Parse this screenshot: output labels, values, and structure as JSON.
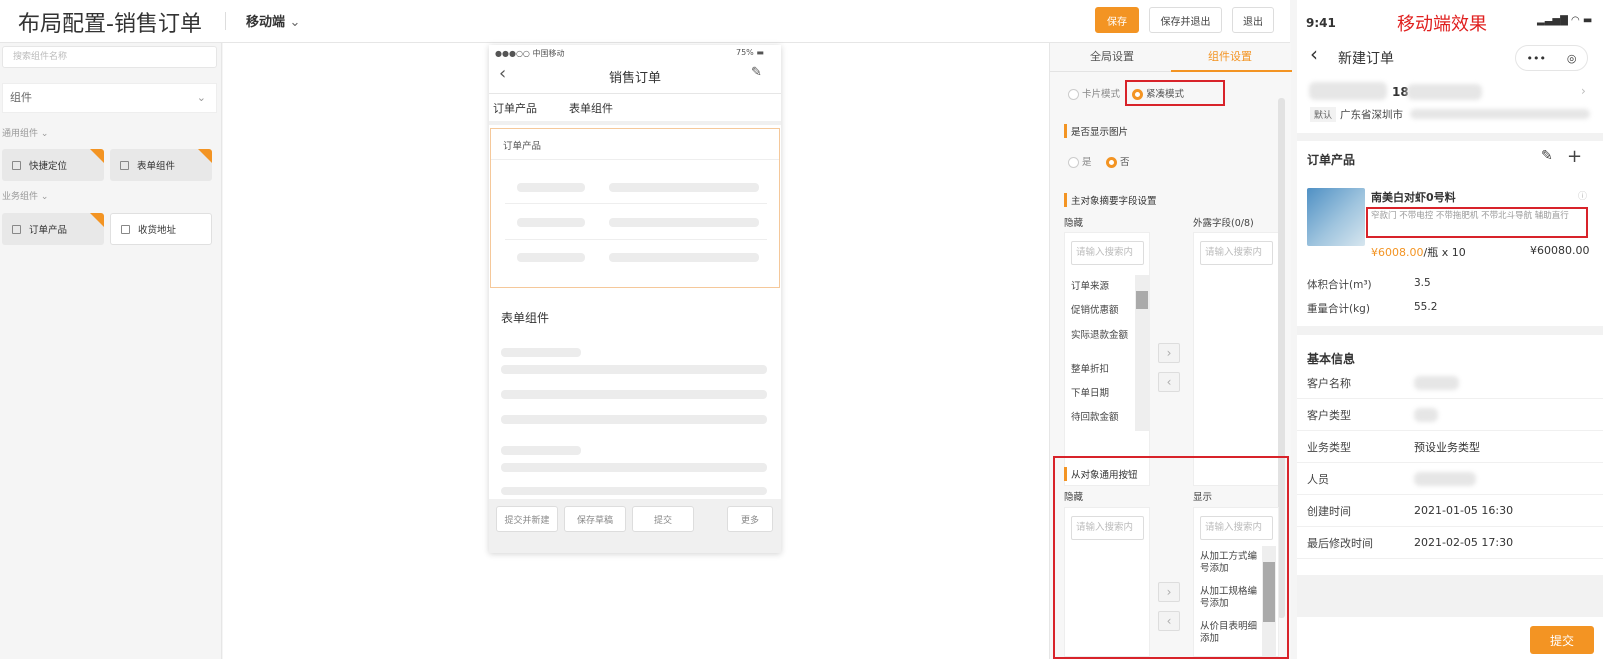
{
  "header": {
    "title": "布局配置-销售订单",
    "mode": "移动端",
    "save": "保存",
    "save_exit": "保存并退出",
    "exit": "退出"
  },
  "left": {
    "search_placeholder": "搜索组件名称",
    "group": "组件",
    "general_section": "通用组件",
    "business_section": "业务组件",
    "general_items": [
      "快捷定位",
      "表单组件"
    ],
    "business_items": [
      "订单产品",
      "收货地址"
    ]
  },
  "phone": {
    "carrier": "●●●○○ 中国移动",
    "battery": "75%",
    "title": "销售订单",
    "tabs": [
      "订单产品",
      "表单组件"
    ],
    "section_products": "订单产品",
    "section_form": "表单组件",
    "buttons": {
      "submit_new": "提交并新建",
      "save_draft": "保存草稿",
      "submit": "提交",
      "more": "更多"
    }
  },
  "config": {
    "tabs": [
      "全局设置",
      "组件设置"
    ],
    "mode_card": "卡片模式",
    "mode_compact": "紧凑模式",
    "show_image_label": "是否显示图片",
    "yes": "是",
    "no": "否",
    "summary_label": "主对象摘要字段设置",
    "hidden": "隐藏",
    "exposed": "外露字段(0/8)",
    "search_placeholder": "请输入搜索内",
    "hidden_fields": [
      "订单来源",
      "促销优惠额",
      "实际退款金额",
      "整单折扣",
      "下单日期",
      "待回款金额"
    ],
    "sub_buttons_label": "从对象通用按钮",
    "hidden2": "隐藏",
    "shown": "显示",
    "shown_buttons": [
      "从加工方式编号添加",
      "从加工规格编号添加",
      "从价目表明细添加"
    ]
  },
  "mobile": {
    "time": "9:41",
    "overlay": "移动端效果",
    "title": "新建订单",
    "phone_prefix": "18",
    "default_tag": "默认",
    "address": "广东省深圳市",
    "products_title": "订单产品",
    "product_name": "南美白对虾0号料",
    "product_tags": "窄款门  不带电控  不带拖肥机  不带北斗导航  辅助直行",
    "price": "¥6008.00",
    "price_unit": "/瓶 x 10",
    "total": "¥60080.00",
    "volume_label": "体积合计(m³)",
    "volume": "3.5",
    "weight_label": "重量合计(kg)",
    "weight": "55.2",
    "basic_title": "基本信息",
    "fields": [
      {
        "k": "客户名称",
        "v": ""
      },
      {
        "k": "客户类型",
        "v": ""
      },
      {
        "k": "业务类型",
        "v": "预设业务类型"
      },
      {
        "k": "人员",
        "v": ""
      },
      {
        "k": "创建时间",
        "v": "2021-01-05 16:30"
      },
      {
        "k": "最后修改时间",
        "v": "2021-02-05 17:30"
      }
    ],
    "submit": "提交"
  },
  "colors": {
    "accent": "#f39423",
    "highlight": "#d8232a"
  }
}
